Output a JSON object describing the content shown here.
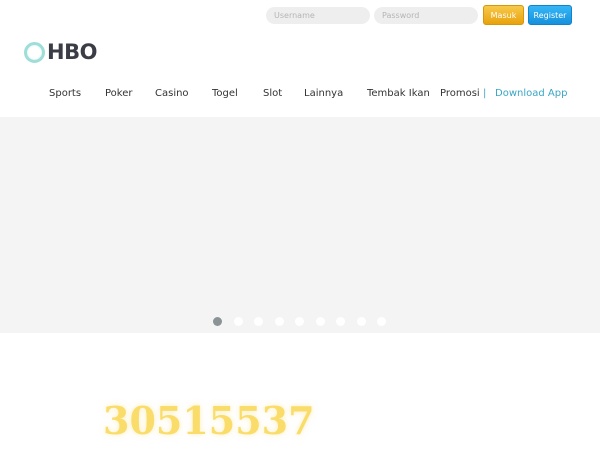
{
  "login": {
    "username_placeholder": "Username",
    "password_placeholder": "Password",
    "masuk_label": "Masuk",
    "register_label": "Register"
  },
  "logo": {
    "text": "HBO"
  },
  "nav": {
    "items": [
      "Sports",
      "Poker",
      "Casino",
      "Togel",
      "Slot",
      "Lainnya",
      "Tembak Ikan",
      "Promosi"
    ],
    "separator": "|",
    "download_label": "Download App"
  },
  "banner": {
    "slide_count": 9,
    "active_slide": 1
  },
  "counter": {
    "value": "30515537"
  },
  "colors": {
    "accent_teal": "#3aa6c4",
    "masuk_yellow": "#f0b52a",
    "register_blue": "#1fa2ea",
    "counter_gold": "#f9dc6a"
  }
}
